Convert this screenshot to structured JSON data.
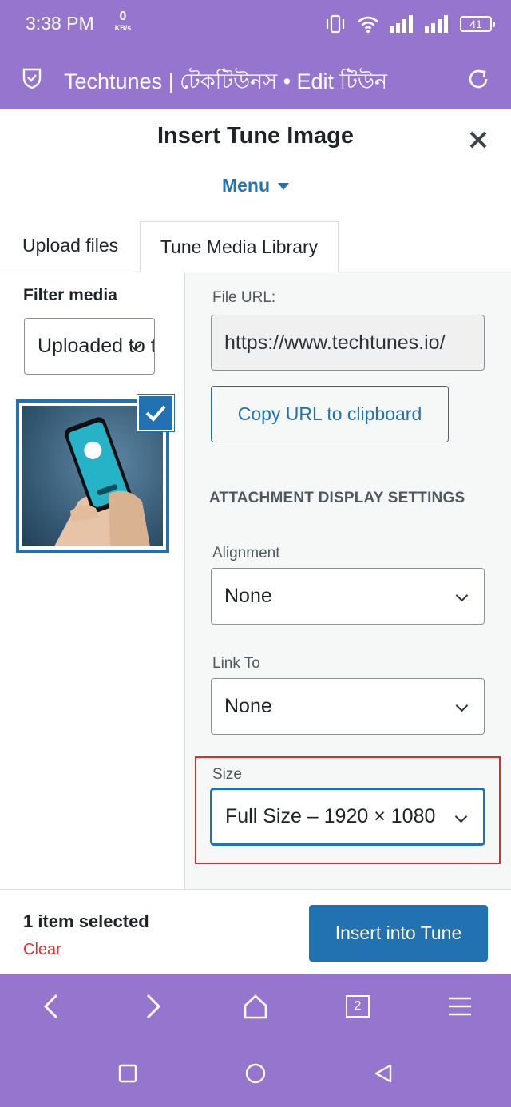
{
  "status_bar": {
    "time": "3:38 PM",
    "net_speed_value": "0",
    "net_speed_unit": "KB/s",
    "battery": "41",
    "icons": [
      "vibrate-icon",
      "wifi-icon",
      "signal-icon",
      "signal-icon",
      "battery-icon"
    ]
  },
  "browser": {
    "title": "Techtunes | টেকটিউনস • Edit টিউন",
    "tab_count": "2"
  },
  "modal": {
    "title": "Insert Tune Image",
    "menu_label": "Menu",
    "tabs": [
      {
        "label": "Upload files",
        "active": false
      },
      {
        "label": "Tune Media Library",
        "active": true
      }
    ]
  },
  "filter": {
    "label": "Filter media",
    "selected": "Uploaded to this tune"
  },
  "attachment": {
    "file_url_label": "File URL:",
    "file_url": "https://www.techtunes.io/",
    "copy_button": "Copy URL to clipboard",
    "display_settings_heading": "ATTACHMENT DISPLAY SETTINGS",
    "alignment_label": "Alignment",
    "alignment_value": "None",
    "link_to_label": "Link To",
    "link_to_value": "None",
    "size_label": "Size",
    "size_value": "Full Size – 1920 × 1080"
  },
  "footer": {
    "selected_count": "1 item selected",
    "clear_label": "Clear",
    "insert_button": "Insert into Tune"
  },
  "colors": {
    "brand_purple": "#9575cd",
    "accent_blue": "#2271b1",
    "danger_red": "#d63638",
    "highlight_red": "#d32f2f"
  }
}
